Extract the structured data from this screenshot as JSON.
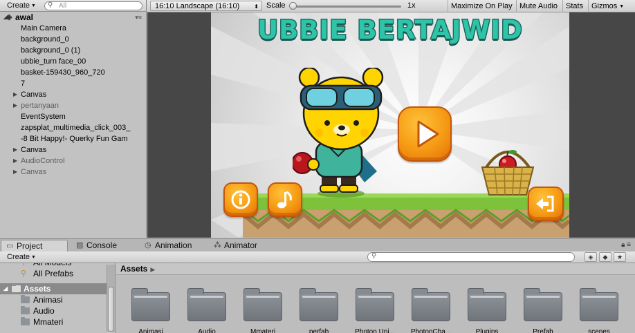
{
  "hierarchy": {
    "create_label": "Create",
    "search_placeholder": "All",
    "scene_name": "awal",
    "items": [
      {
        "label": "Main Camera",
        "dim": false,
        "arrow": false
      },
      {
        "label": "background_0",
        "dim": false,
        "arrow": false
      },
      {
        "label": "background_0 (1)",
        "dim": false,
        "arrow": false
      },
      {
        "label": "ubbie_turn face_00",
        "dim": false,
        "arrow": false
      },
      {
        "label": "basket-159430_960_720",
        "dim": false,
        "arrow": false
      },
      {
        "label": "7",
        "dim": false,
        "arrow": false
      },
      {
        "label": "Canvas",
        "dim": false,
        "arrow": true
      },
      {
        "label": "pertanyaan",
        "dim": true,
        "arrow": true
      },
      {
        "label": "EventSystem",
        "dim": false,
        "arrow": false
      },
      {
        "label": "zapsplat_multimedia_click_003_",
        "dim": false,
        "arrow": false
      },
      {
        "label": "-8 Bit Happy!- Querky Fun Gam",
        "dim": false,
        "arrow": false
      },
      {
        "label": "Canvas",
        "dim": false,
        "arrow": true
      },
      {
        "label": "AudioControl",
        "dim": true,
        "arrow": true
      },
      {
        "label": "Canvas",
        "dim": true,
        "arrow": true
      }
    ]
  },
  "game_toolbar": {
    "aspect": "16:10 Landscape (16:10)",
    "scale_label": "Scale",
    "scale_value": "1x",
    "scale_fraction": 0.0,
    "maximize": "Maximize On Play",
    "mute": "Mute Audio",
    "stats": "Stats",
    "gizmos": "Gizmos"
  },
  "game": {
    "title": "UBBIE BERTAJWID"
  },
  "dock": {
    "tabs": [
      {
        "label": "Project",
        "icon": "folder-icon",
        "glyph": "▭"
      },
      {
        "label": "Console",
        "icon": "console-icon",
        "glyph": "▤"
      },
      {
        "label": "Animation",
        "icon": "animation-icon",
        "glyph": "◷"
      },
      {
        "label": "Animator",
        "icon": "animator-icon",
        "glyph": "⁂"
      }
    ]
  },
  "project": {
    "create_label": "Create",
    "left_items": [
      {
        "label": "All Models",
        "type": "search"
      },
      {
        "label": "All Prefabs",
        "type": "search"
      },
      {
        "label": "Assets",
        "type": "root"
      },
      {
        "label": "Animasi",
        "type": "folder"
      },
      {
        "label": "Audio",
        "type": "folder"
      },
      {
        "label": "Mmateri",
        "type": "folder"
      }
    ],
    "breadcrumb": "Assets",
    "assets": [
      "Animasi",
      "Audio",
      "Mmateri",
      "perfab",
      "Photon Uni...",
      "PhotonCha...",
      "Plugins",
      "Prefab",
      "scenes"
    ]
  },
  "colors": {
    "title_fill": "#2ec4a8",
    "title_stroke": "#1f6b62",
    "button_orange": "#f59a14",
    "grass": "#7dc23a",
    "dirt": "#c9a070"
  }
}
